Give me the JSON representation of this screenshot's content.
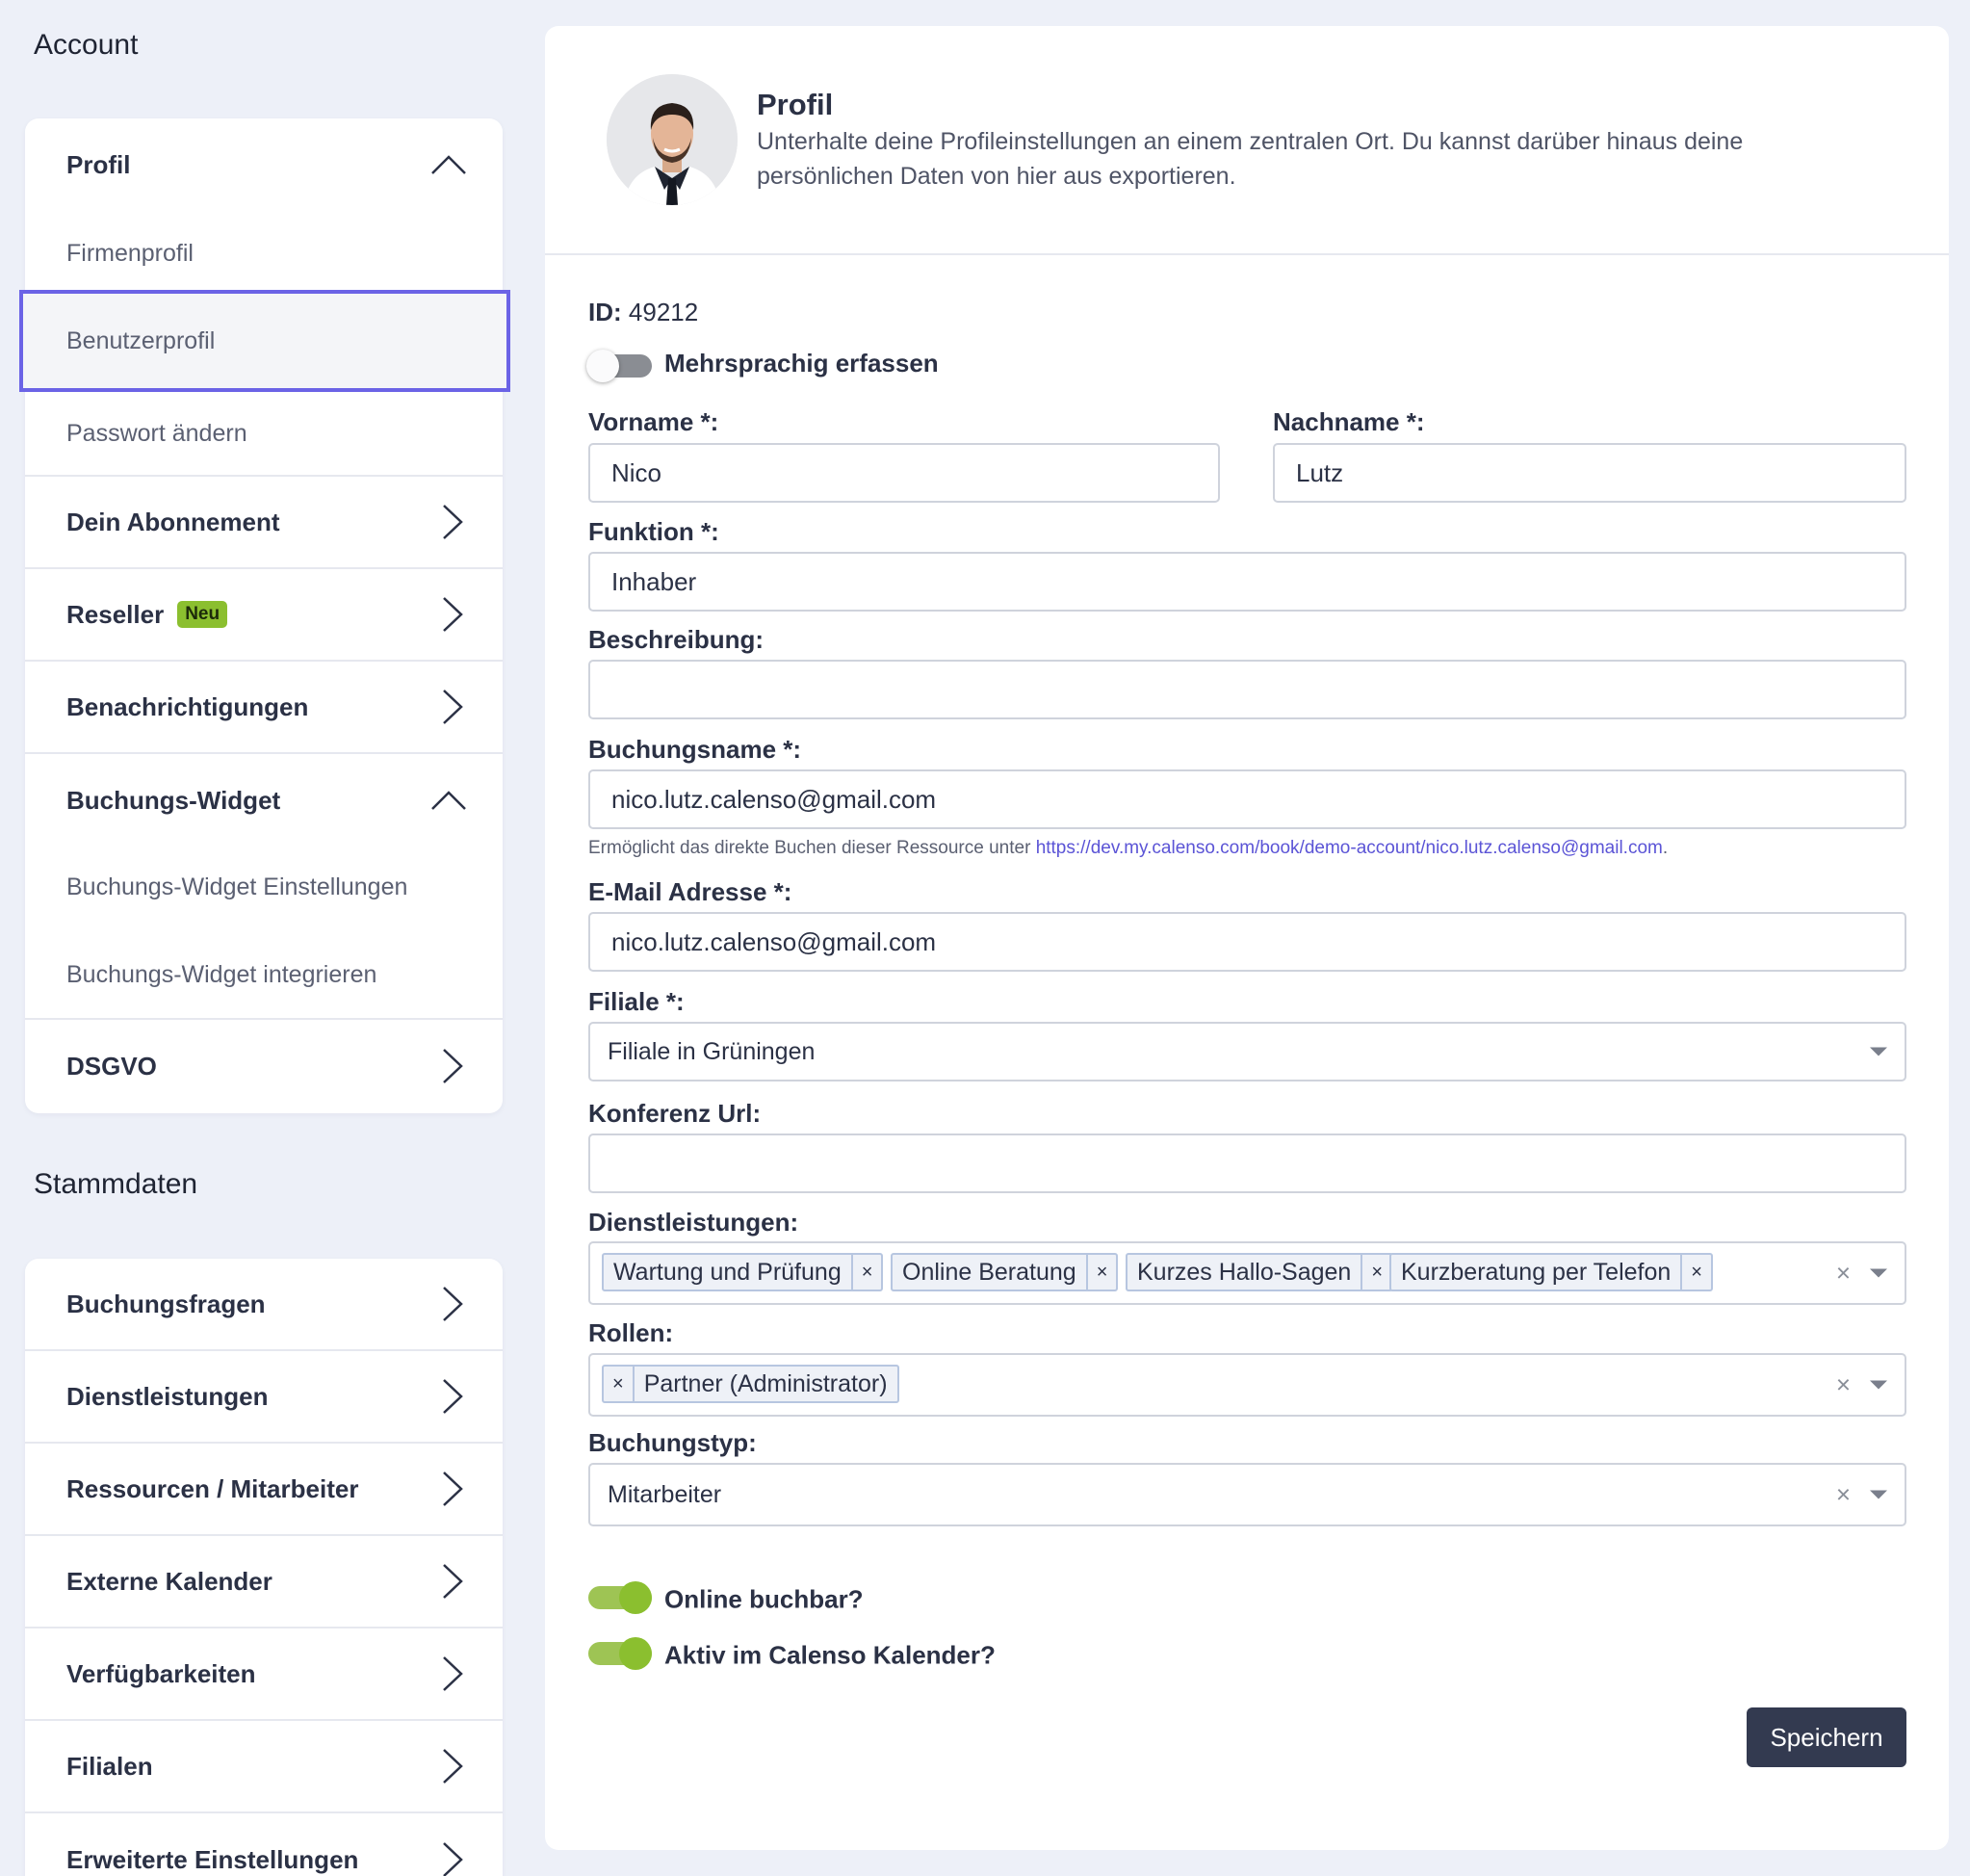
{
  "sidebar": {
    "account_title": "Account",
    "stammdaten_title": "Stammdaten",
    "profil": {
      "label": "Profil",
      "subitems": [
        "Firmenprofil",
        "Benutzerprofil",
        "Passwort ändern"
      ]
    },
    "abonnement": "Dein Abonnement",
    "reseller": {
      "label": "Reseller",
      "badge": "Neu"
    },
    "benachrichtigungen": "Benachrichtigungen",
    "widget": {
      "label": "Buchungs-Widget",
      "subitems": [
        "Buchungs-Widget Einstellungen",
        "Buchungs-Widget integrieren"
      ]
    },
    "dsgvo": "DSGVO",
    "stammdaten_items": [
      "Buchungsfragen",
      "Dienstleistungen",
      "Ressourcen / Mitarbeiter",
      "Externe Kalender",
      "Verfügbarkeiten",
      "Filialen",
      "Erweiterte Einstellungen"
    ]
  },
  "header": {
    "title": "Profil",
    "description": "Unterhalte deine Profileinstellungen an einem zentralen Ort. Du kannst darüber hinaus deine persönlichen Daten von hier aus exportieren."
  },
  "form": {
    "id_label": "ID:",
    "id_value": "49212",
    "multilang_label": "Mehrsprachig erfassen",
    "vorname_label": "Vorname *:",
    "vorname_value": "Nico",
    "nachname_label": "Nachname *:",
    "nachname_value": "Lutz",
    "funktion_label": "Funktion *:",
    "funktion_value": "Inhaber",
    "beschreibung_label": "Beschreibung:",
    "beschreibung_value": "",
    "buchungsname_label": "Buchungsname *:",
    "buchungsname_value": "nico.lutz.calenso@gmail.com",
    "hint_prefix": "Ermöglicht das direkte Buchen dieser Ressource unter ",
    "hint_link": "https://dev.my.calenso.com/book/demo-account/nico.lutz.calenso@gmail.com",
    "hint_suffix": ".",
    "email_label": "E-Mail Adresse *:",
    "email_value": "nico.lutz.calenso@gmail.com",
    "filiale_label": "Filiale *:",
    "filiale_value": "Filiale in Grüningen",
    "konferenz_label": "Konferenz Url:",
    "konferenz_value": "",
    "dienstleistungen_label": "Dienstleistungen:",
    "dienstleistungen_chips": [
      "Wartung und Prüfung",
      "Online Beratung",
      "Kurzes Hallo-Sagen",
      "Kurzberatung per Telefon"
    ],
    "rollen_label": "Rollen:",
    "rollen_chip": "Partner (Administrator)",
    "buchungstyp_label": "Buchungstyp:",
    "buchungstyp_value": "Mitarbeiter",
    "online_label": "Online buchbar?",
    "aktiv_label": "Aktiv im Calenso Kalender?",
    "save_label": "Speichern",
    "chip_remove": "×",
    "clear_all": "×"
  },
  "toggles": {
    "mehrsprachig": false,
    "online_buchbar": true,
    "aktiv_kalender": true
  },
  "colors": {
    "accent": "#6b63e6",
    "toggle_on": "#8bbf2f",
    "primary_button": "#333a50",
    "link": "#5b54d6"
  }
}
